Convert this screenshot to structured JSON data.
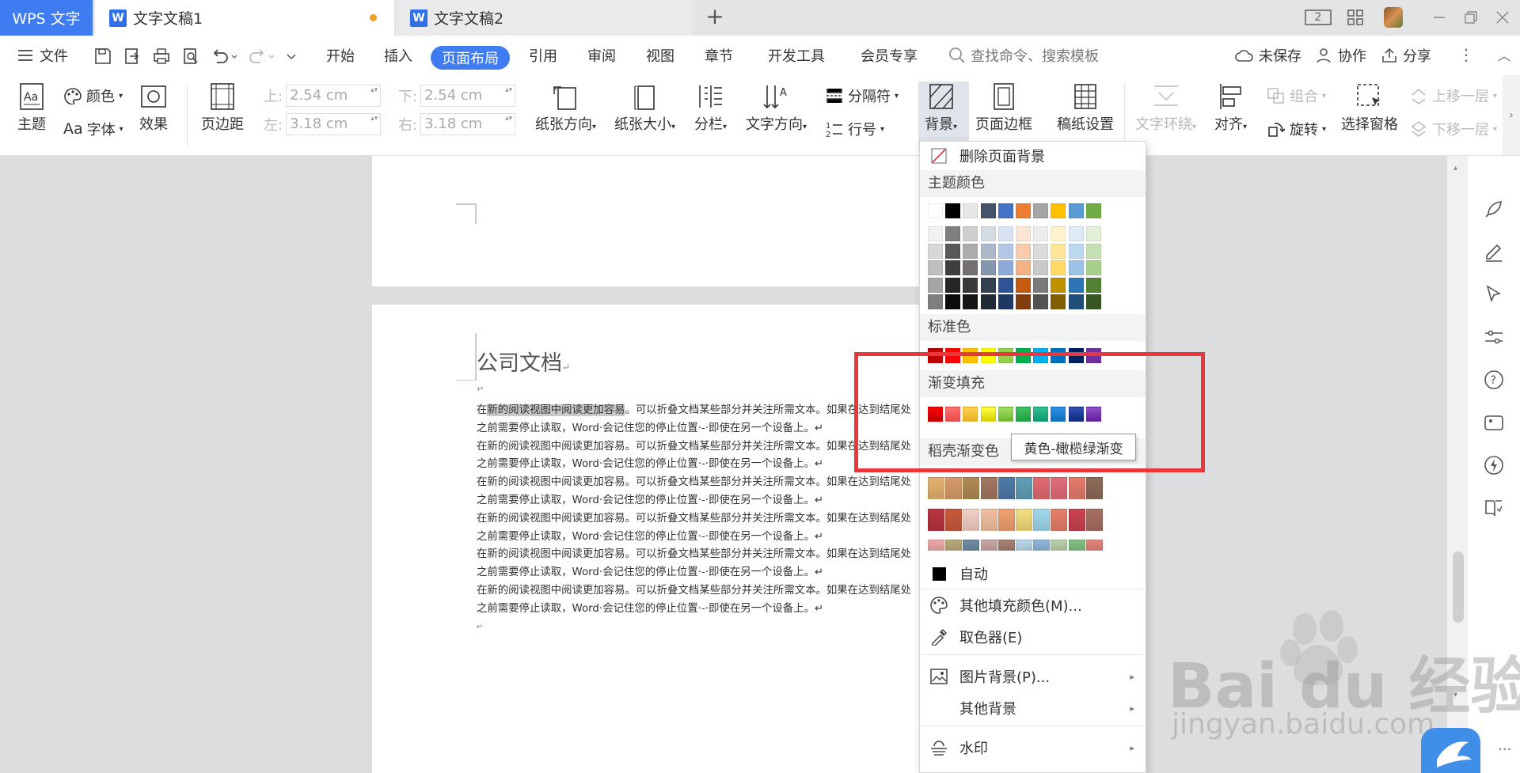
{
  "tabs": {
    "app": "WPS 文字",
    "doc1": "文字文稿1",
    "doc2": "文字文稿2",
    "new_tab": "+"
  },
  "titlebar": {
    "page_count": "2"
  },
  "menu": {
    "file": "文件",
    "items": [
      "开始",
      "插入",
      "页面布局",
      "引用",
      "审阅",
      "视图",
      "章节",
      "开发工具",
      "会员专享"
    ],
    "active": "页面布局",
    "search": "查找命令、搜索模板",
    "unsaved": "未保存",
    "collab": "协作",
    "share": "分享"
  },
  "ribbon": {
    "theme": "主题",
    "color": "颜色",
    "font": "字体",
    "effect": "效果",
    "margins": "页边距",
    "top_label": "上:",
    "top_value": "2.54 cm",
    "bottom_label": "下:",
    "bottom_value": "2.54 cm",
    "left_label": "左:",
    "left_value": "3.18 cm",
    "right_label": "右:",
    "right_value": "3.18 cm",
    "orientation": "纸张方向",
    "size": "纸张大小",
    "columns": "分栏",
    "text_direction": "文字方向",
    "separator": "分隔符",
    "line_number": "行号",
    "background": "背景",
    "page_border": "页面边框",
    "manuscript": "稿纸设置",
    "text_wrap": "文字环绕",
    "align": "对齐",
    "group": "组合",
    "rotate": "旋转",
    "selection_pane": "选择窗格",
    "bring_forward": "上移一层",
    "send_backward": "下移一层"
  },
  "document": {
    "title": "公司文档",
    "line_a": "在新的阅读视图中阅读更加容易。可以折叠文档某些部分并关注所需文本。如果在达到结尾处",
    "line_a_hl": "新的阅读视图中阅读更加容易",
    "line_a_pre": "在",
    "line_a_post": "。可以折叠文档某些部分并关注所需文本。如果在达到结尾处",
    "line_b": "之前需要停止读取，Word·会记住您的停止位置·-·即使在另一个设备上。↵",
    "mark": "↵"
  },
  "dropdown": {
    "remove_bg": "删除页面背景",
    "theme_colors": "主题颜色",
    "standard_colors": "标准色",
    "gradient_fill": "渐变填充",
    "shell_gradient": "稻壳渐变色",
    "auto": "自动",
    "more_fill": "其他填充颜色(M)...",
    "picker": "取色器(E)",
    "picture_bg": "图片背景(P)...",
    "other_bg": "其他背景",
    "watermark": "水印",
    "tooltip": "黄色-橄榄绿渐变",
    "theme_top": [
      "#ffffff",
      "#000000",
      "#e7e6e6",
      "#44546a",
      "#4472c4",
      "#ed7d31",
      "#a5a5a5",
      "#ffc000",
      "#5b9bd5",
      "#70ad47"
    ],
    "theme_shades": [
      [
        "#f2f2f2",
        "#7f7f7f",
        "#d0cece",
        "#d6dce4",
        "#d9e2f3",
        "#fbe5d5",
        "#ededed",
        "#fff2cc",
        "#deebf6",
        "#e2efd9"
      ],
      [
        "#d8d8d8",
        "#595959",
        "#aeabab",
        "#adb9ca",
        "#b4c6e7",
        "#f7cbac",
        "#dbdbdb",
        "#fee599",
        "#bdd7ee",
        "#c5e0b3"
      ],
      [
        "#bfbfbf",
        "#3f3f3f",
        "#757070",
        "#8496b0",
        "#8eaadb",
        "#f4b183",
        "#c9c9c9",
        "#ffd965",
        "#9cc3e5",
        "#a8d08d"
      ],
      [
        "#a5a5a5",
        "#262626",
        "#3a3838",
        "#323f4f",
        "#2f5496",
        "#c55a11",
        "#7b7b7b",
        "#bf9000",
        "#2e75b5",
        "#538135"
      ],
      [
        "#7f7f7f",
        "#0c0c0c",
        "#171616",
        "#222a35",
        "#1e3864",
        "#833c0b",
        "#525252",
        "#7f6000",
        "#1e4e79",
        "#375623"
      ]
    ],
    "standard": [
      "#c00000",
      "#ff0000",
      "#ffc000",
      "#ffff00",
      "#92d050",
      "#00b050",
      "#00b0f0",
      "#0070c0",
      "#002060",
      "#7030a0"
    ],
    "gradients": [
      [
        "#c00000",
        "#ff0000"
      ],
      [
        "#e84a4a",
        "#ff7070"
      ],
      [
        "#e8b020",
        "#ffd050"
      ],
      [
        "#d8d000",
        "#ffff40"
      ],
      [
        "#70b830",
        "#a0e060"
      ],
      [
        "#20a040",
        "#40c060"
      ],
      [
        "#109870",
        "#30c090"
      ],
      [
        "#1070c0",
        "#3090e0"
      ],
      [
        "#102880",
        "#3050b0"
      ],
      [
        "#6020a0",
        "#9050c8"
      ]
    ],
    "shell_rows": [
      [
        "#e4b170",
        "#d79a6a",
        "#b08a55",
        "#a2775e",
        "#4f79a8",
        "#5e9fb5",
        "#e26a70",
        "#e36c7a",
        "#e47a6c",
        "#8e6a58"
      ],
      [
        "#b8343f",
        "#c85a3c",
        "#f2cfc5",
        "#f3c09f",
        "#f0a070",
        "#f3dd7d",
        "#9fd8ea",
        "#e67f6a",
        "#c9424f",
        "#a56f62"
      ],
      [
        "#f0a8a6",
        "#b9a97a",
        "#6f8ca2",
        "#c9a6a6",
        "#a78072",
        "#b8d8ec",
        "#8fb6dc",
        "#b9cfa8",
        "#7fc07f",
        "#e2847a"
      ]
    ]
  }
}
